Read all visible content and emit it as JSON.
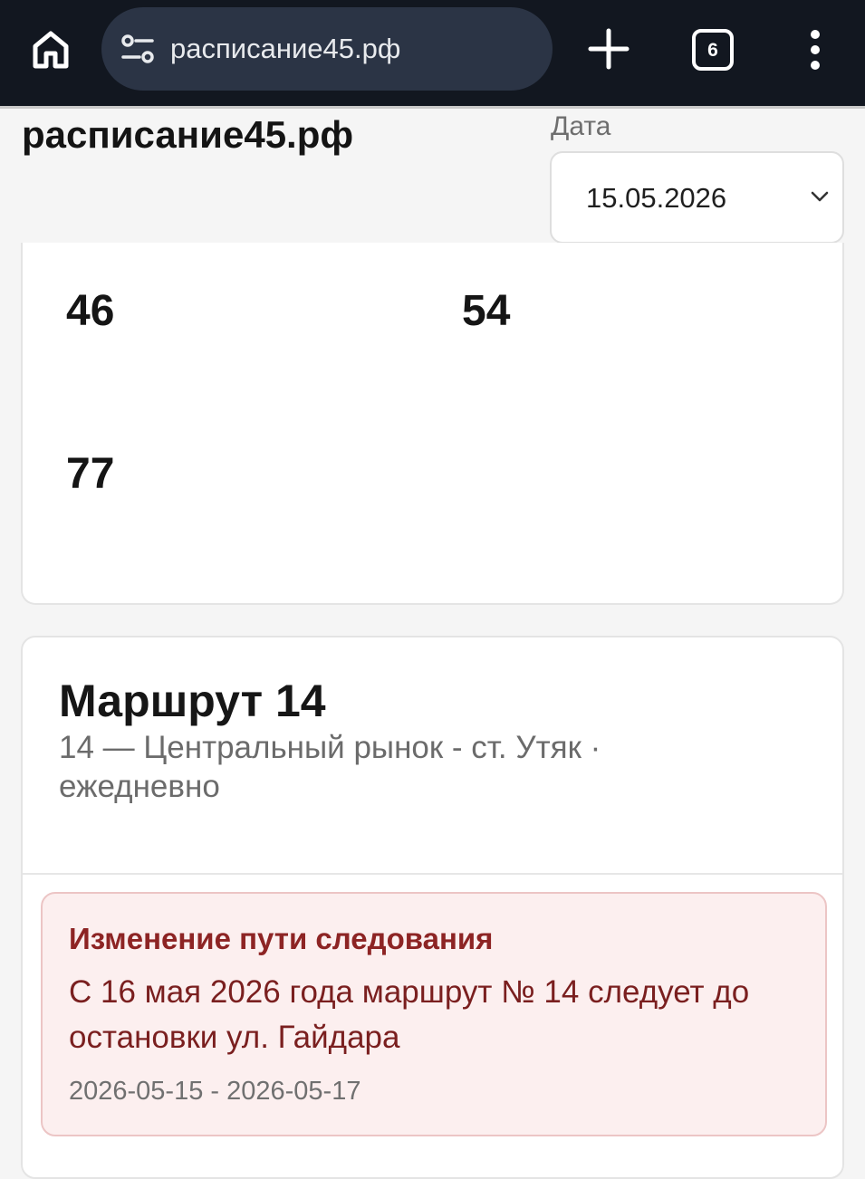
{
  "browser": {
    "url": "расписание45.рф",
    "tab_count": "6",
    "icons": {
      "home": "home-icon",
      "site_settings": "tune-icon",
      "new_tab": "plus-icon",
      "tabs": "tab-switcher-icon",
      "menu": "more-vert-icon"
    }
  },
  "header": {
    "site_title": "расписание45.рф",
    "date_label": "Дата",
    "date_value": "15.05.2026"
  },
  "route_numbers": [
    "46",
    "54",
    "77"
  ],
  "route": {
    "title": "Маршрут 14",
    "description": "14 — Центральный рынок - ст. Утяк · ежедневно"
  },
  "notice": {
    "title": "Изменение пути следования",
    "text": "С 16 мая 2026 года маршрут № 14 следует до остановки ул. Гайдара",
    "dates": "2026-05-15 - 2026-05-17"
  },
  "colors": {
    "toolbar_bg": "#121720",
    "omnibox_bg": "#2b3445",
    "notice_bg": "#fcefef",
    "notice_border": "#ecc5c5",
    "notice_title": "#8d2424"
  }
}
